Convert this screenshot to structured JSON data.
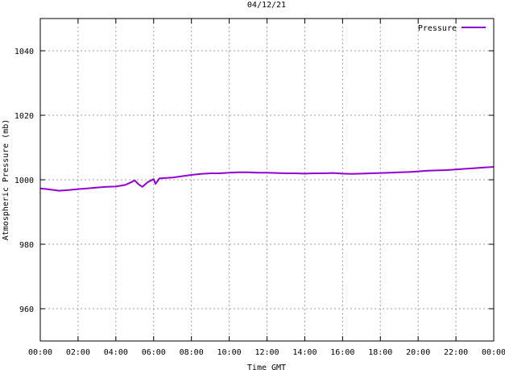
{
  "chart_data": {
    "type": "line",
    "title": "04/12/21",
    "xlabel": "Time GMT",
    "ylabel": "Atmospheric Pressure (mb)",
    "x_tick_labels": [
      "00:00",
      "02:00",
      "04:00",
      "06:00",
      "08:00",
      "10:00",
      "12:00",
      "14:00",
      "16:00",
      "18:00",
      "20:00",
      "22:00",
      "00:00"
    ],
    "x_range_hours": [
      0,
      24
    ],
    "y_ticks": [
      960,
      980,
      1000,
      1020,
      1040
    ],
    "ylim": [
      950,
      1050
    ],
    "grid": true,
    "legend_position": "top-right",
    "series": [
      {
        "name": "Pressure",
        "color": "#9400d3",
        "x": [
          0,
          0.5,
          1,
          1.5,
          2,
          2.5,
          3,
          3.5,
          4,
          4.5,
          4.8,
          5,
          5.2,
          5.4,
          5.7,
          6,
          6.1,
          6.3,
          6.5,
          7,
          7.5,
          8,
          8.5,
          9,
          9.5,
          10,
          10.5,
          11,
          11.5,
          12,
          12.5,
          13,
          13.5,
          14,
          14.5,
          15,
          15.5,
          16,
          16.5,
          17,
          17.5,
          18,
          18.5,
          19,
          19.5,
          20,
          20.5,
          21,
          21.5,
          22,
          22.5,
          23,
          23.5,
          24
        ],
        "y": [
          997.3,
          997.0,
          996.6,
          996.8,
          997.1,
          997.3,
          997.6,
          997.8,
          997.9,
          998.4,
          999.2,
          999.8,
          998.6,
          997.8,
          999.3,
          1000.2,
          998.7,
          1000.4,
          1000.5,
          1000.7,
          1001.1,
          1001.5,
          1001.8,
          1002.0,
          1002.0,
          1002.2,
          1002.3,
          1002.3,
          1002.2,
          1002.2,
          1002.1,
          1002.0,
          1002.0,
          1001.9,
          1002.0,
          1002.0,
          1002.1,
          1001.9,
          1001.8,
          1001.9,
          1002.0,
          1002.1,
          1002.2,
          1002.3,
          1002.4,
          1002.6,
          1002.8,
          1002.9,
          1003.0,
          1003.2,
          1003.4,
          1003.6,
          1003.8,
          1004.0
        ]
      }
    ]
  }
}
